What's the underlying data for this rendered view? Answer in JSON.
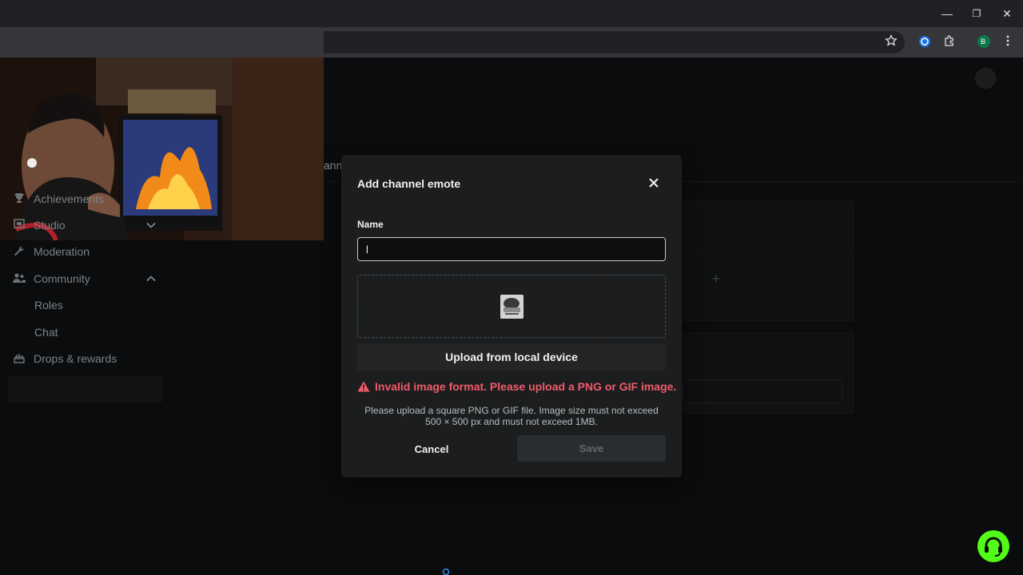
{
  "browser": {
    "window_controls": {
      "minimize": "—",
      "restore": "❐",
      "close": "✕"
    },
    "profile_initial": "B"
  },
  "sidebar": {
    "items": [
      {
        "label": "Achievements",
        "icon": "trophy-icon"
      },
      {
        "label": "Studio",
        "icon": "studio-icon"
      },
      {
        "label": "Moderation",
        "icon": "wrench-icon"
      },
      {
        "label": "Community",
        "icon": "people-icon"
      },
      {
        "label": "Drops & rewards",
        "icon": "gift-icon"
      }
    ],
    "community_sub": [
      {
        "label": "Roles"
      },
      {
        "label": "Chat"
      }
    ]
  },
  "background": {
    "partial_text": "ann"
  },
  "modal": {
    "title": "Add channel emote",
    "name_label": "Name",
    "name_value": "l",
    "upload_label": "Upload from local device",
    "error_text": "Invalid image format. Please upload a PNG or GIF image.",
    "help_line1": "Please upload a square PNG or GIF file. Image size must not exceed",
    "help_line2": "500 × 500 px and must not exceed 1MB.",
    "cancel_label": "Cancel",
    "save_label": "Save"
  },
  "colors": {
    "accent_green": "#53fc18",
    "error_red": "#f05b6b"
  }
}
